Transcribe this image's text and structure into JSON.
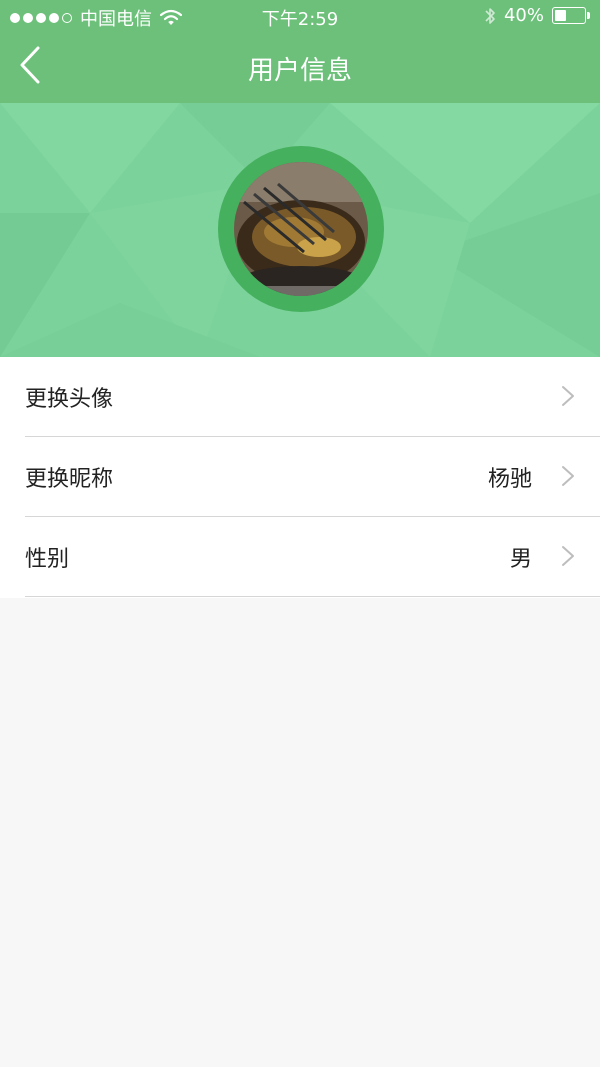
{
  "status_bar": {
    "carrier": "中国电信",
    "time": "下午2:59",
    "battery_percent": "40%",
    "battery_level": 0.4,
    "signal_bars_filled": 4,
    "signal_bars_total": 5,
    "icons": [
      "wifi-icon",
      "bluetooth-icon",
      "battery-icon"
    ]
  },
  "nav": {
    "title": "用户信息",
    "back_icon": "chevron-left-icon"
  },
  "colors": {
    "nav_green": "#6cc07a",
    "banner_green": "#7bd29a",
    "avatar_ring": "#45b05e",
    "background": "#f7f7f7"
  },
  "profile": {
    "avatar_icon": "avatar-photo"
  },
  "settings": {
    "items": [
      {
        "label": "更换头像",
        "value": ""
      },
      {
        "label": "更换昵称",
        "value": "杨驰"
      },
      {
        "label": "性别",
        "value": "男"
      }
    ]
  }
}
